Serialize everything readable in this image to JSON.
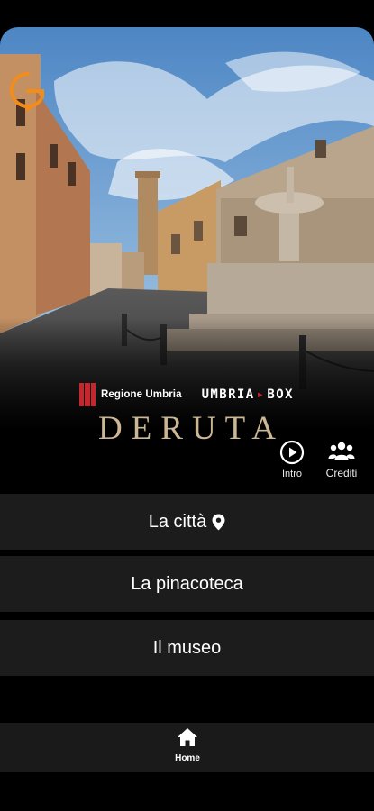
{
  "brand": {
    "partner_1": "Regione Umbria",
    "partner_2_left": "UMBRIA",
    "partner_2_right": "BOX",
    "title": "DERUTA"
  },
  "actions": {
    "intro_label": "Intro",
    "crediti_label": "Crediti"
  },
  "menu": [
    {
      "label": "La città",
      "icon": "map-pin-icon"
    },
    {
      "label": "La pinacoteca"
    },
    {
      "label": "Il museo"
    }
  ],
  "bottom_nav": {
    "home_label": "Home",
    "home_icon": "home-icon"
  },
  "colors": {
    "title_gold": "#cbb793",
    "logo_orange": "#f28c1b",
    "accent_red": "#c6262e",
    "button_bg": "#1c1c1c"
  }
}
